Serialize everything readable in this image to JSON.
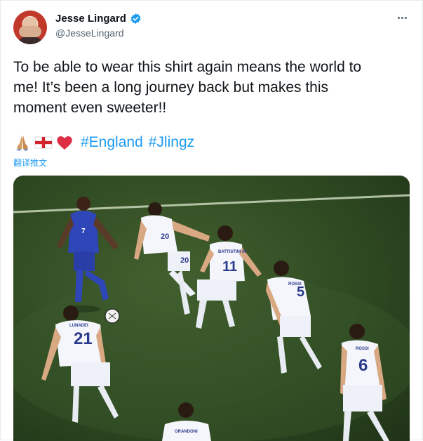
{
  "author": {
    "display_name": "Jesse Lingard",
    "handle": "@JesseLingard",
    "verified_icon": "verified-badge-icon"
  },
  "tweet": {
    "text": "To be able to wear this shirt again means the world to\nme! It’s been a long journey back but makes this\nmoment even sweeter!!",
    "emojis": [
      "folded-hands",
      "england-flag",
      "red-heart"
    ],
    "hashtags": [
      "#England",
      "#Jlingz"
    ],
    "translate_label": "翻译推文"
  },
  "media": {
    "description_icon": "football-match-photo",
    "players": [
      {
        "number": "7",
        "name": ""
      },
      {
        "number": "20",
        "name": ""
      },
      {
        "number": "11",
        "name": "BATTISTINI M."
      },
      {
        "number": "5",
        "name": "ROSSI"
      },
      {
        "number": "21",
        "name": "LUNADEI"
      },
      {
        "number": "6",
        "name": "ROSSI"
      },
      {
        "number": "",
        "name": "GRANDONI"
      }
    ]
  },
  "colors": {
    "accent": "#1d9bf0",
    "text": "#0f1419",
    "secondary": "#536471",
    "england_kit": "#2f46b8",
    "opponent_kit": "#f4f6fb",
    "pitch": "#34512a"
  }
}
